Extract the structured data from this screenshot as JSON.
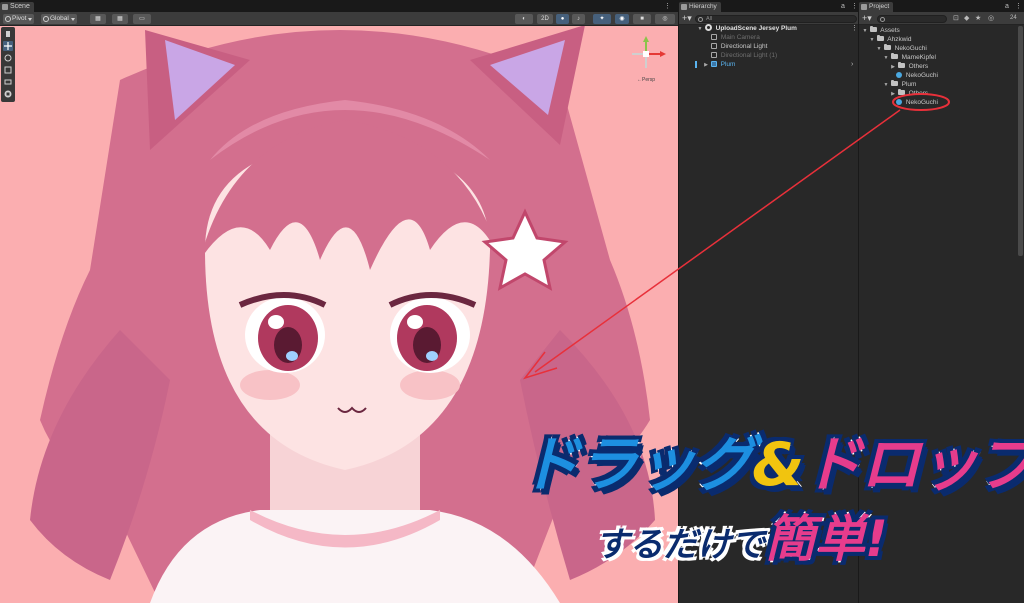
{
  "scene": {
    "tab_label": "Scene",
    "pivot_label": "Pivot",
    "global_label": "Global",
    "toolbar_2d_label": "2D",
    "gizmo_label": "←Persp",
    "viewport": {
      "background_color": "#fbaeb0",
      "hair_color": "#d36f8e",
      "skin_color": "#fde3e3",
      "eye_color": "#b0395e",
      "ear_inner_color": "#c9a6e6",
      "star_color": "#ffffff",
      "shirt_color": "#fbf3f5"
    }
  },
  "hierarchy": {
    "tab_label": "Hierarchy",
    "search_placeholder": "All",
    "scene_name": "UploadScene Jersey Plum",
    "items": [
      {
        "label": "Main Camera",
        "state": "inactive"
      },
      {
        "label": "Directional Light",
        "state": "normal"
      },
      {
        "label": "Directional Light (1)",
        "state": "inactive"
      },
      {
        "label": "Plum",
        "state": "prefab"
      }
    ]
  },
  "project": {
    "tab_label": "Project",
    "item_count": "24",
    "tree": [
      {
        "label": "Assets",
        "depth": 0
      },
      {
        "label": "Ahzkwid",
        "depth": 1
      },
      {
        "label": "NekoGuchi",
        "depth": 2
      },
      {
        "label": "MameKipfel",
        "depth": 3
      },
      {
        "label": "Others",
        "depth": 4
      },
      {
        "label": "NekoGuchi",
        "depth": 4
      },
      {
        "label": "Plum",
        "depth": 3
      },
      {
        "label": "Others",
        "depth": 4
      },
      {
        "label": "NekoGuchi",
        "depth": 4
      }
    ]
  },
  "callout": {
    "line1_part1": "ドラッグ",
    "line1_amp": "&",
    "line1_part2": "ドロップ",
    "line2_text": "するだけで",
    "line2_emphasis": "簡単!",
    "arrow_color": "#e8303a",
    "highlight_color": "#e8303a"
  }
}
